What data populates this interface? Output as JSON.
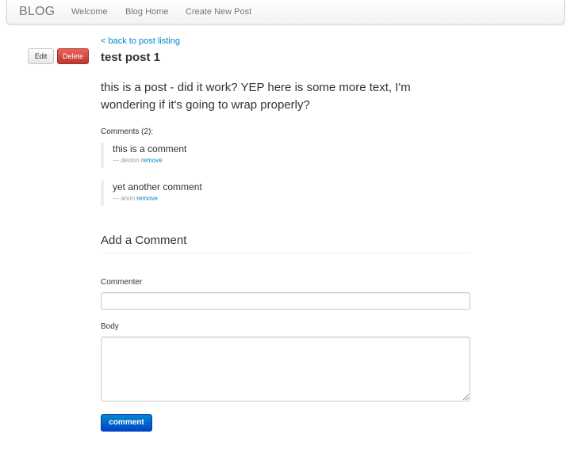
{
  "navbar": {
    "brand": "BLOG",
    "links": [
      "Welcome",
      "Blog Home",
      "Create New Post"
    ]
  },
  "actions": {
    "edit_label": "Edit",
    "delete_label": "Delete"
  },
  "post": {
    "back_link": "< back to post listing",
    "title": "test post 1",
    "body": "this is a post - did it work? YEP here is some more text, I'm wondering if it's going to wrap properly?"
  },
  "comments": {
    "header": "Comments (2):",
    "items": [
      {
        "text": "this is a comment",
        "author": "— devion",
        "remove_label": "remove"
      },
      {
        "text": "yet another comment",
        "author": "— anon",
        "remove_label": "remove"
      }
    ]
  },
  "form": {
    "title": "Add a Comment",
    "commenter_label": "Commenter",
    "commenter_value": "",
    "body_label": "Body",
    "body_value": "",
    "submit_label": "comment"
  },
  "colors": {
    "link": "#0088cc",
    "danger": "#da4f49",
    "primary": "#0055cc"
  }
}
